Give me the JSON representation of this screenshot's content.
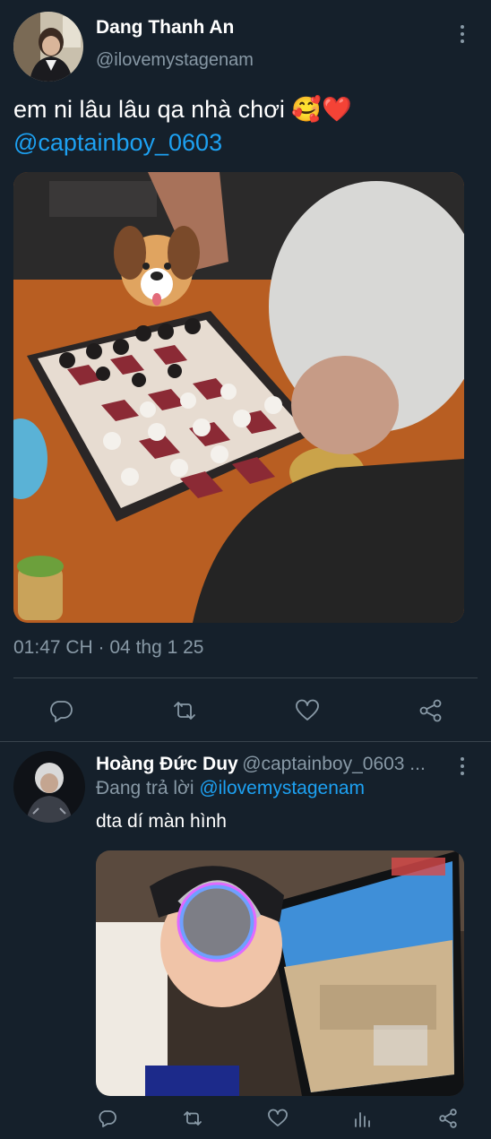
{
  "main_tweet": {
    "author_name": "Dang Thanh An",
    "author_handle": "@ilovemystagenam",
    "text": "em ni lâu lâu qa nhà chơi",
    "emoji": "🥰❤️",
    "mention": "@captainboy_0603",
    "timestamp": "01:47 CH · 04 thg 1 25",
    "actions": [
      "reply",
      "retweet",
      "like",
      "share"
    ],
    "icons": [
      "more-icon",
      "reply-icon",
      "retweet-icon",
      "like-icon",
      "share-icon"
    ]
  },
  "reply_tweet": {
    "author_name": "Hoàng Đức Duy",
    "author_handle": "@captainboy_0603 ...",
    "replying_label": "Đang trả lời",
    "replying_to": "@ilovemystagenam",
    "text": "dta dí màn hình",
    "actions": [
      "reply",
      "retweet",
      "like",
      "views",
      "share"
    ]
  },
  "colors": {
    "background": "#15202b",
    "divider": "#38444d",
    "secondary_text": "#8899a6",
    "link": "#1da1f2"
  }
}
